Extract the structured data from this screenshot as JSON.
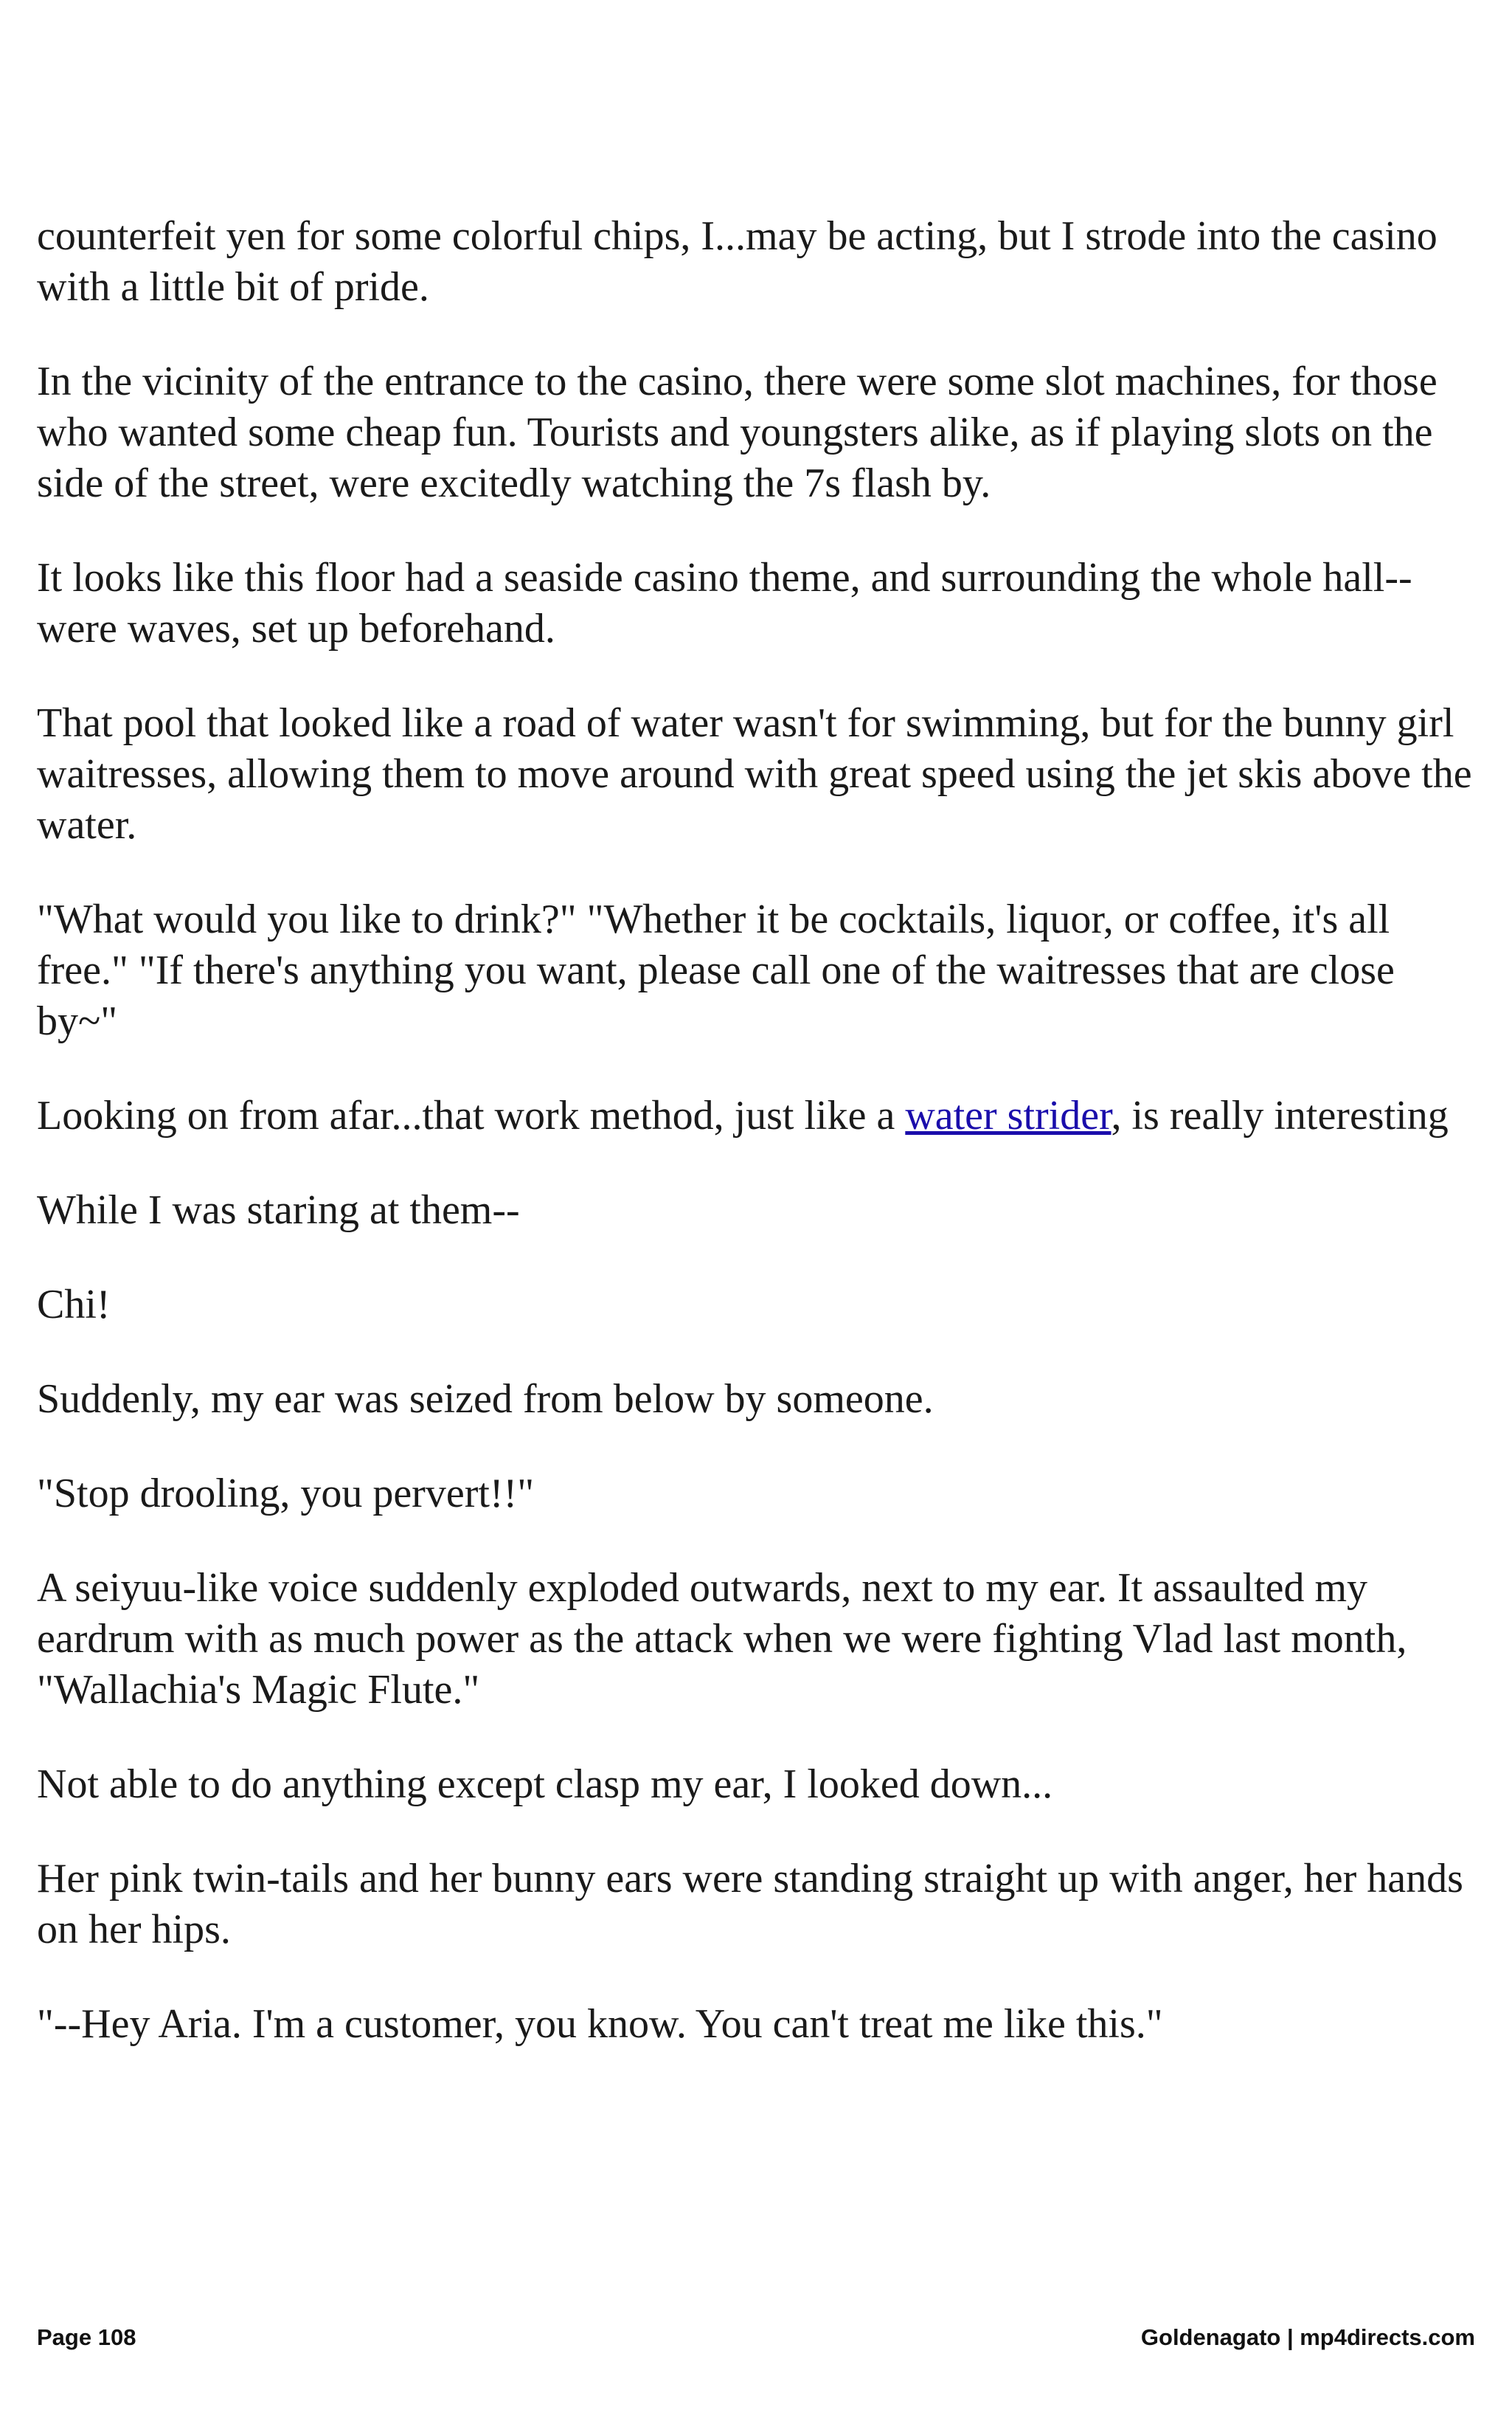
{
  "paragraphs": [
    "counterfeit yen for some colorful chips, I...may be acting, but I strode into the casino with a little bit of pride.",
    "In the vicinity of the entrance to the casino, there were some slot machines, for those who wanted some cheap fun. Tourists and youngsters alike, as if playing slots on the side of the street, were excitedly watching the 7s flash by.",
    "It looks like this floor had a seaside casino theme, and surrounding the whole hall--were waves, set up beforehand.",
    "That pool that looked like a road of water wasn't for swimming, but for the bunny girl waitresses, allowing them to move around with great speed using the jet skis above the water.",
    "\"What would you like to drink?\" \"Whether it be cocktails, liquor, or coffee, it's all free.\" \"If there's anything you want, please call one of the waitresses that are close by~\""
  ],
  "link_paragraph": {
    "before": "Looking on from afar...that work method, just like a ",
    "link_text": "water strider",
    "after": ", is really interesting"
  },
  "paragraphs2": [
    "While I was staring at them--",
    "Chi!",
    "Suddenly, my ear was seized from below by someone.",
    "\"Stop drooling, you pervert!!\"",
    "A seiyuu-like voice suddenly exploded outwards, next to my ear. It assaulted my eardrum with as much power as the attack when we were fighting Vlad last month, \"Wallachia's Magic Flute.\"",
    "Not able to do anything except clasp my ear, I looked down...",
    "Her pink twin-tails and her bunny ears were standing straight up with anger, her hands on her hips.",
    "\"--Hey Aria. I'm a customer, you know. You can't treat me like this.\""
  ],
  "footer": {
    "page_label": "Page 108",
    "credit": "Goldenagato | mp4directs.com"
  },
  "colors": {
    "text": "#1a1a1a",
    "link": "#1a0dab",
    "background": "#ffffff"
  }
}
